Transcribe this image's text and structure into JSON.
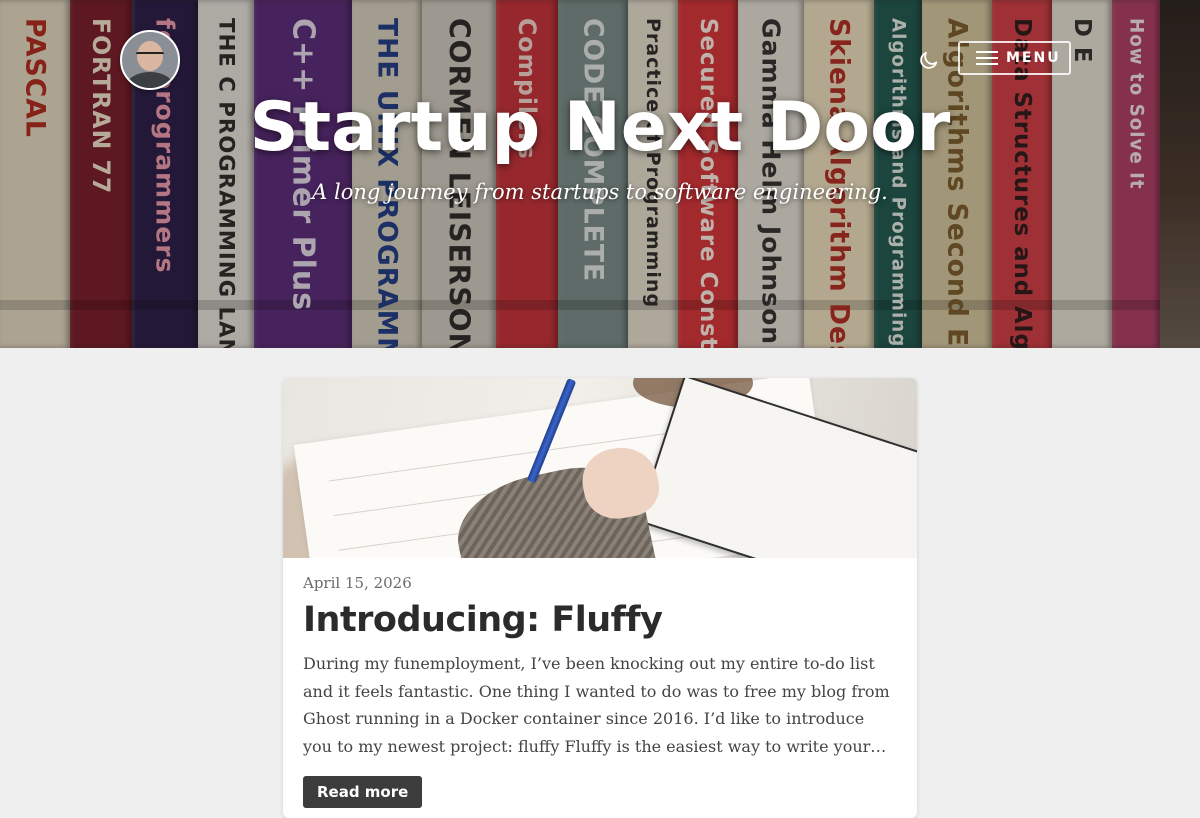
{
  "site": {
    "title": "Startup Next Door",
    "description": "A long journey from startups to software engineering."
  },
  "header": {
    "avatar_icon": "author-avatar",
    "theme_toggle_icon": "moon-icon",
    "menu_icon": "hamburger-icon",
    "menu_label": "MENU"
  },
  "hero_books": [
    {
      "spine": "PASCAL",
      "color": "#e7ddc5",
      "text_color": "#b22a1e"
    },
    {
      "spine": "FORTRAN 77",
      "color": "#7a1c2a",
      "text_color": "#f4e6d0"
    },
    {
      "spine": "for programmers",
      "color": "#2a1d4a",
      "text_color": "#f29fb2"
    },
    {
      "spine": "THE C PROGRAMMING LANGUAGE",
      "color": "#e8e6e0",
      "text_color": "#2b2b2b"
    },
    {
      "spine": "C++ Primer Plus",
      "color": "#5b2b7d",
      "text_color": "#e7dff0"
    },
    {
      "spine": "THE UNIX PROGRAMMING ENVIRONMENT",
      "color": "#d9d4c2",
      "text_color": "#1f3e8a"
    },
    {
      "spine": "CORMEN LEISERSON RIVEST",
      "color": "#d3cfc4",
      "text_color": "#2c2c2c"
    },
    {
      "spine": "Compilers",
      "color": "#c8323b",
      "text_color": "#f6d8d0"
    },
    {
      "spine": "CODE COMPLETE",
      "color": "#7a8f8c",
      "text_color": "#e6ece9"
    },
    {
      "spine": "Practice of Programming",
      "color": "#e9e3d3",
      "text_color": "#2d2d2d"
    },
    {
      "spine": "Secured Software Construction",
      "color": "#d9343a",
      "text_color": "#fff1e8"
    },
    {
      "spine": "Gamma Helm Johnson Vlissides",
      "color": "#e7e3da",
      "text_color": "#333333"
    },
    {
      "spine": "Skiena Algorithm Design Manual",
      "color": "#f0e4c3",
      "text_color": "#b32f25"
    },
    {
      "spine": "Algorithms and Programming",
      "color": "#1f5a52",
      "text_color": "#e6efe9"
    },
    {
      "spine": "Algorithms Second Edition",
      "color": "#d9cba3",
      "text_color": "#7a5d2c"
    },
    {
      "spine": "Data Structures and Algorithms in Python",
      "color": "#d33e47",
      "text_color": "#2d1b1b"
    },
    {
      "spine": "D E",
      "color": "#e9e5d9",
      "text_color": "#333333"
    },
    {
      "spine": "How to Solve It",
      "color": "#b03f67",
      "text_color": "#f7e6ee"
    }
  ],
  "post": {
    "date": "April 15, 2026",
    "title": "Introducing: Fluffy",
    "excerpt": "During my funemployment, I’ve been knocking out my entire to-do list and it feels fantastic. One thing I wanted to do was to free my blog from Ghost running in a Docker container since 2016. I’d like to introduce you to my newest project: fluffy Fluffy is the easiest way to write your…",
    "read_more_label": "Read more",
    "image_icon": "writing-photo"
  }
}
